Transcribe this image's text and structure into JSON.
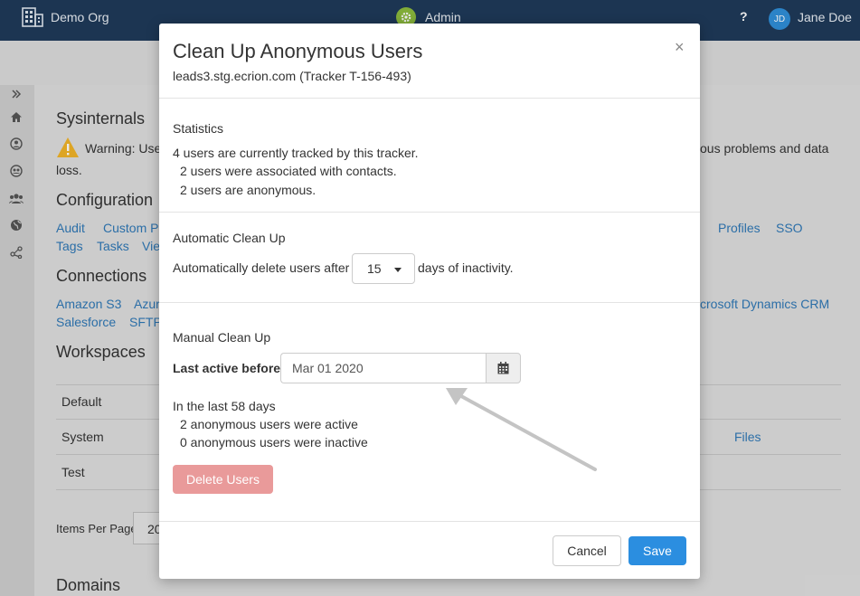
{
  "topbar": {
    "org_name": "Demo Org",
    "section": "Admin",
    "help": "?",
    "user_initials": "JD",
    "user_name": "Jane Doe"
  },
  "background": {
    "sysinternals": "Sysinternals",
    "warning_left": "Warning: Use",
    "warning_right": "ous problems and data",
    "warning_loss": "loss.",
    "configuration": "Configuration",
    "config_links_row1": [
      "Audit",
      "Custom Pa",
      "Profiles",
      "SSO"
    ],
    "config_links_row2": [
      "Tags",
      "Tasks",
      "Vie"
    ],
    "connections": "Connections",
    "conn_links_row1": [
      "Amazon S3",
      "Azur",
      "crosoft Dynamics CRM"
    ],
    "conn_links_row2": [
      "Salesforce",
      "SFTP"
    ],
    "workspaces": "Workspaces",
    "workspace_rows": [
      "Default",
      "System",
      "Test"
    ],
    "system_files": "Files",
    "items_per_page": "Items Per Page",
    "items_per_page_value": "20",
    "domains": "Domains"
  },
  "modal": {
    "title": "Clean Up Anonymous Users",
    "subtitle": "leads3.stg.ecrion.com (Tracker T-156-493)",
    "close": "×",
    "statistics": {
      "label": "Statistics",
      "total": "4 users are currently tracked by this tracker.",
      "associated": "2 users were associated with contacts.",
      "anonymous": "2 users are anonymous."
    },
    "auto": {
      "label": "Automatic Clean Up",
      "prefix": "Automatically delete users after",
      "days": "15",
      "suffix": "days of inactivity."
    },
    "manual": {
      "label": "Manual Clean Up",
      "last_active_label": "Last active before",
      "date_value": "Mar 01 2020",
      "period": "In the last 58 days",
      "active": "2 anonymous users were active",
      "inactive": "0 anonymous users were inactive",
      "delete_label": "Delete Users"
    },
    "footer": {
      "cancel_label": "Cancel",
      "save_label": "Save"
    }
  },
  "colors": {
    "topbar": "#1f3a5a",
    "primary": "#2b8ee0",
    "danger_disabled": "#e99a9a",
    "link": "#2f78b6",
    "warning": "#f0b429"
  }
}
